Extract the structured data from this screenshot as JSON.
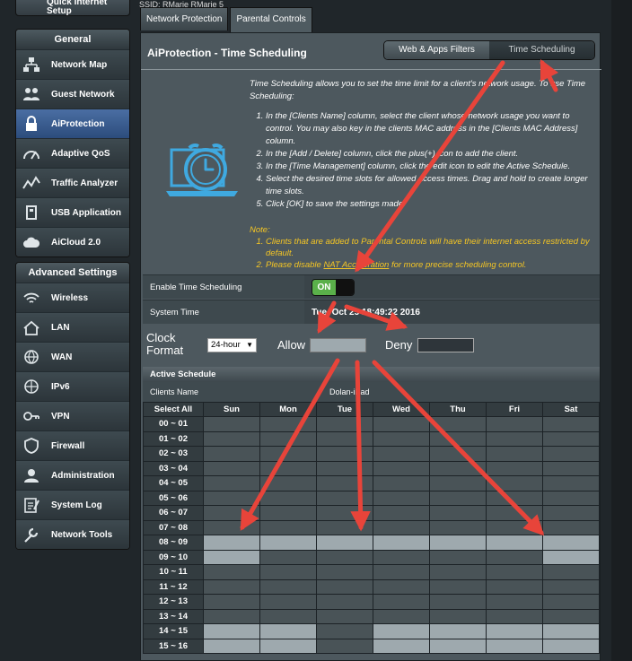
{
  "top_text": "SSID: RMarie  RMarie 5",
  "quick_label": "Quick Internet Setup",
  "sidebar": {
    "general_title": "General",
    "general_items": [
      {
        "label": "Network Map",
        "icon": "network-map-icon"
      },
      {
        "label": "Guest Network",
        "icon": "guest-network-icon"
      },
      {
        "label": "AiProtection",
        "icon": "lock-icon",
        "active": true
      },
      {
        "label": "Adaptive QoS",
        "icon": "qos-icon"
      },
      {
        "label": "Traffic Analyzer",
        "icon": "traffic-analyzer-icon"
      },
      {
        "label": "USB Application",
        "icon": "usb-icon"
      },
      {
        "label": "AiCloud 2.0",
        "icon": "cloud-icon"
      }
    ],
    "advanced_title": "Advanced Settings",
    "advanced_items": [
      {
        "label": "Wireless",
        "icon": "wifi-icon"
      },
      {
        "label": "LAN",
        "icon": "home-icon"
      },
      {
        "label": "WAN",
        "icon": "globe-icon"
      },
      {
        "label": "IPv6",
        "icon": "ipv6-icon"
      },
      {
        "label": "VPN",
        "icon": "vpn-icon"
      },
      {
        "label": "Firewall",
        "icon": "shield-icon"
      },
      {
        "label": "Administration",
        "icon": "admin-icon"
      },
      {
        "label": "System Log",
        "icon": "log-icon"
      },
      {
        "label": "Network Tools",
        "icon": "tools-icon"
      }
    ]
  },
  "tabs": [
    "Network Protection",
    "Parental Controls"
  ],
  "page_title": "AiProtection - Time Scheduling",
  "switcher": {
    "left": "Web & Apps Filters",
    "right": "Time Scheduling"
  },
  "description": {
    "intro": "Time Scheduling allows you to set the time limit for a client's network usage. To use Time Scheduling:",
    "steps": [
      "In the [Clients Name] column, select the client whose network usage you want to control. You may also key in the clients MAC address in the [Clients MAC Address] column.",
      "In the [Add / Delete] column, click the plus(+) icon to add the client.",
      "In the [Time Management] column, click the edit icon to edit the Active Schedule.",
      "Select the desired time slots for allowed access times. Drag and hold to create longer time slots.",
      "Click [OK] to save the settings made."
    ]
  },
  "note": {
    "title": "Note:",
    "item1": "Clients that are added to Parental Controls will have their internet access restricted by default.",
    "item2_pre": "Please disable ",
    "item2_link": "NAT Acceleration",
    "item2_post": " for more precise scheduling control."
  },
  "settings": {
    "enable_label": "Enable Time Scheduling",
    "toggle_value": "ON",
    "systime_label": "System Time",
    "systime_value": "Tue, Oct 25 18:49:22 2016"
  },
  "clock_format": {
    "label1": "Clock",
    "label2": "Format",
    "value": "24-hour"
  },
  "legend": {
    "allow": "Allow",
    "deny": "Deny"
  },
  "schedule": {
    "header": "Active Schedule",
    "clients_label": "Clients Name",
    "client_name": "Dolan-iPad",
    "select_all": "Select All",
    "days": [
      "Sun",
      "Mon",
      "Tue",
      "Wed",
      "Thu",
      "Fri",
      "Sat"
    ],
    "rows": [
      {
        "time": "00 ~ 01",
        "allowed": [
          0,
          0,
          0,
          0,
          0,
          0,
          0
        ]
      },
      {
        "time": "01 ~ 02",
        "allowed": [
          0,
          0,
          0,
          0,
          0,
          0,
          0
        ]
      },
      {
        "time": "02 ~ 03",
        "allowed": [
          0,
          0,
          0,
          0,
          0,
          0,
          0
        ]
      },
      {
        "time": "03 ~ 04",
        "allowed": [
          0,
          0,
          0,
          0,
          0,
          0,
          0
        ]
      },
      {
        "time": "04 ~ 05",
        "allowed": [
          0,
          0,
          0,
          0,
          0,
          0,
          0
        ]
      },
      {
        "time": "05 ~ 06",
        "allowed": [
          0,
          0,
          0,
          0,
          0,
          0,
          0
        ]
      },
      {
        "time": "06 ~ 07",
        "allowed": [
          0,
          0,
          0,
          0,
          0,
          0,
          0
        ]
      },
      {
        "time": "07 ~ 08",
        "allowed": [
          0,
          0,
          0,
          0,
          0,
          0,
          0
        ]
      },
      {
        "time": "08 ~ 09",
        "allowed": [
          1,
          1,
          1,
          1,
          1,
          1,
          1
        ]
      },
      {
        "time": "09 ~ 10",
        "allowed": [
          1,
          0,
          0,
          0,
          0,
          0,
          1
        ]
      },
      {
        "time": "10 ~ 11",
        "allowed": [
          0,
          0,
          0,
          0,
          0,
          0,
          0
        ]
      },
      {
        "time": "11 ~ 12",
        "allowed": [
          0,
          0,
          0,
          0,
          0,
          0,
          0
        ]
      },
      {
        "time": "12 ~ 13",
        "allowed": [
          0,
          0,
          0,
          0,
          0,
          0,
          0
        ]
      },
      {
        "time": "13 ~ 14",
        "allowed": [
          0,
          0,
          0,
          0,
          0,
          0,
          0
        ]
      },
      {
        "time": "14 ~ 15",
        "allowed": [
          1,
          1,
          0,
          1,
          1,
          1,
          1
        ]
      },
      {
        "time": "15 ~ 16",
        "allowed": [
          1,
          1,
          0,
          1,
          1,
          1,
          1
        ]
      }
    ]
  },
  "colors": {
    "allow": "#9ea9ae",
    "deny": "#495357",
    "accent": "#e8443a",
    "active_menu": "#3a5d90",
    "toggle_on": "#5ab04a"
  }
}
